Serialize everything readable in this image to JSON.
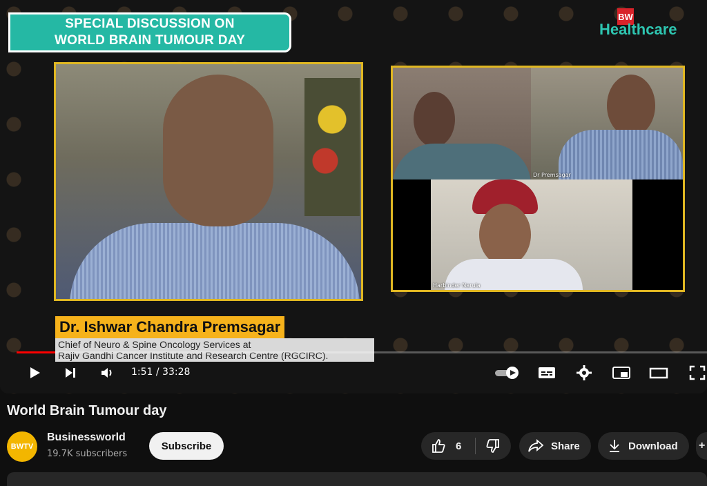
{
  "video": {
    "banner_line1": "SPECIAL DISCUSSION ON",
    "banner_line2": "WORLD BRAIN TUMOUR DAY",
    "brand_badge": "BW",
    "brand_name": "Healthcare",
    "tile_label_2": "Dr Premsagar",
    "tile_label_3": "Harbinder Narula",
    "speaker_name": "Dr. Ishwar Chandra Premsagar",
    "speaker_title_line1": "Chief of Neuro & Spine Oncology Services at",
    "speaker_title_line2": "Rajiv Gandhi Cancer Institute and Research Centre (RGCIRC).",
    "time_display": "1:51 / 33:28",
    "progress_fraction": 0.0556
  },
  "meta": {
    "title": "World Brain Tumour day",
    "channel_name": "Businessworld",
    "channel_avatar_text": "BWTV",
    "subscribers": "19.7K subscribers",
    "subscribe_label": "Subscribe",
    "like_count": "6",
    "share_label": "Share",
    "download_label": "Download"
  },
  "colors": {
    "accent_red": "#ff0000",
    "banner_teal": "#25b8a4",
    "frame_gold": "#e0b722",
    "name_bar": "#f6b21b"
  }
}
